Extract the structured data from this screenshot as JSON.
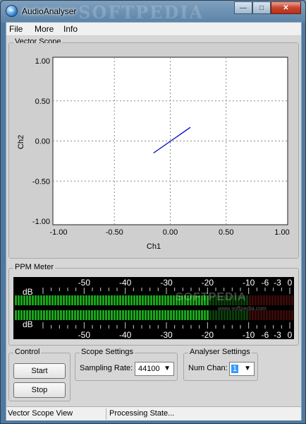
{
  "window": {
    "title": "AudioAnalyser",
    "watermark": "SOFTPEDIA",
    "icon": "app-icon"
  },
  "menu": [
    {
      "label": "File"
    },
    {
      "label": "More"
    },
    {
      "label": "Info"
    }
  ],
  "vector_scope": {
    "title": "Vector Scope",
    "xlabel": "Ch1",
    "ylabel": "Ch2",
    "x_ticks": [
      "-1.00",
      "-0.50",
      "0.00",
      "0.50",
      "1.00"
    ],
    "y_ticks": [
      "1.00",
      "0.50",
      "0.00",
      "-0.50",
      "-1.00"
    ]
  },
  "ppm_meter": {
    "title": "PPM Meter",
    "unit": "dB",
    "scale": [
      "-50",
      "-40",
      "-30",
      "-20",
      "-10",
      "-6",
      "-3",
      "0"
    ],
    "ch1_level_db": -20,
    "ch2_level_db": -20,
    "watermark": "SOFTPEDIA",
    "watermark_url": "www.softpedia.com"
  },
  "control": {
    "title": "Control",
    "start_label": "Start",
    "stop_label": "Stop"
  },
  "scope_settings": {
    "title": "Scope Settings",
    "sampling_label": "Sampling Rate:",
    "sampling_value": "44100"
  },
  "analyser_settings": {
    "title": "Analyser Settings",
    "numchan_label": "Num Chan:",
    "numchan_value": "1"
  },
  "status": {
    "left": "Vector Scope View",
    "right": "Processing State..."
  },
  "colors": {
    "trace": "#0000cc",
    "meter_on": "#1aa51a",
    "meter_off": "#0a3d0a"
  }
}
